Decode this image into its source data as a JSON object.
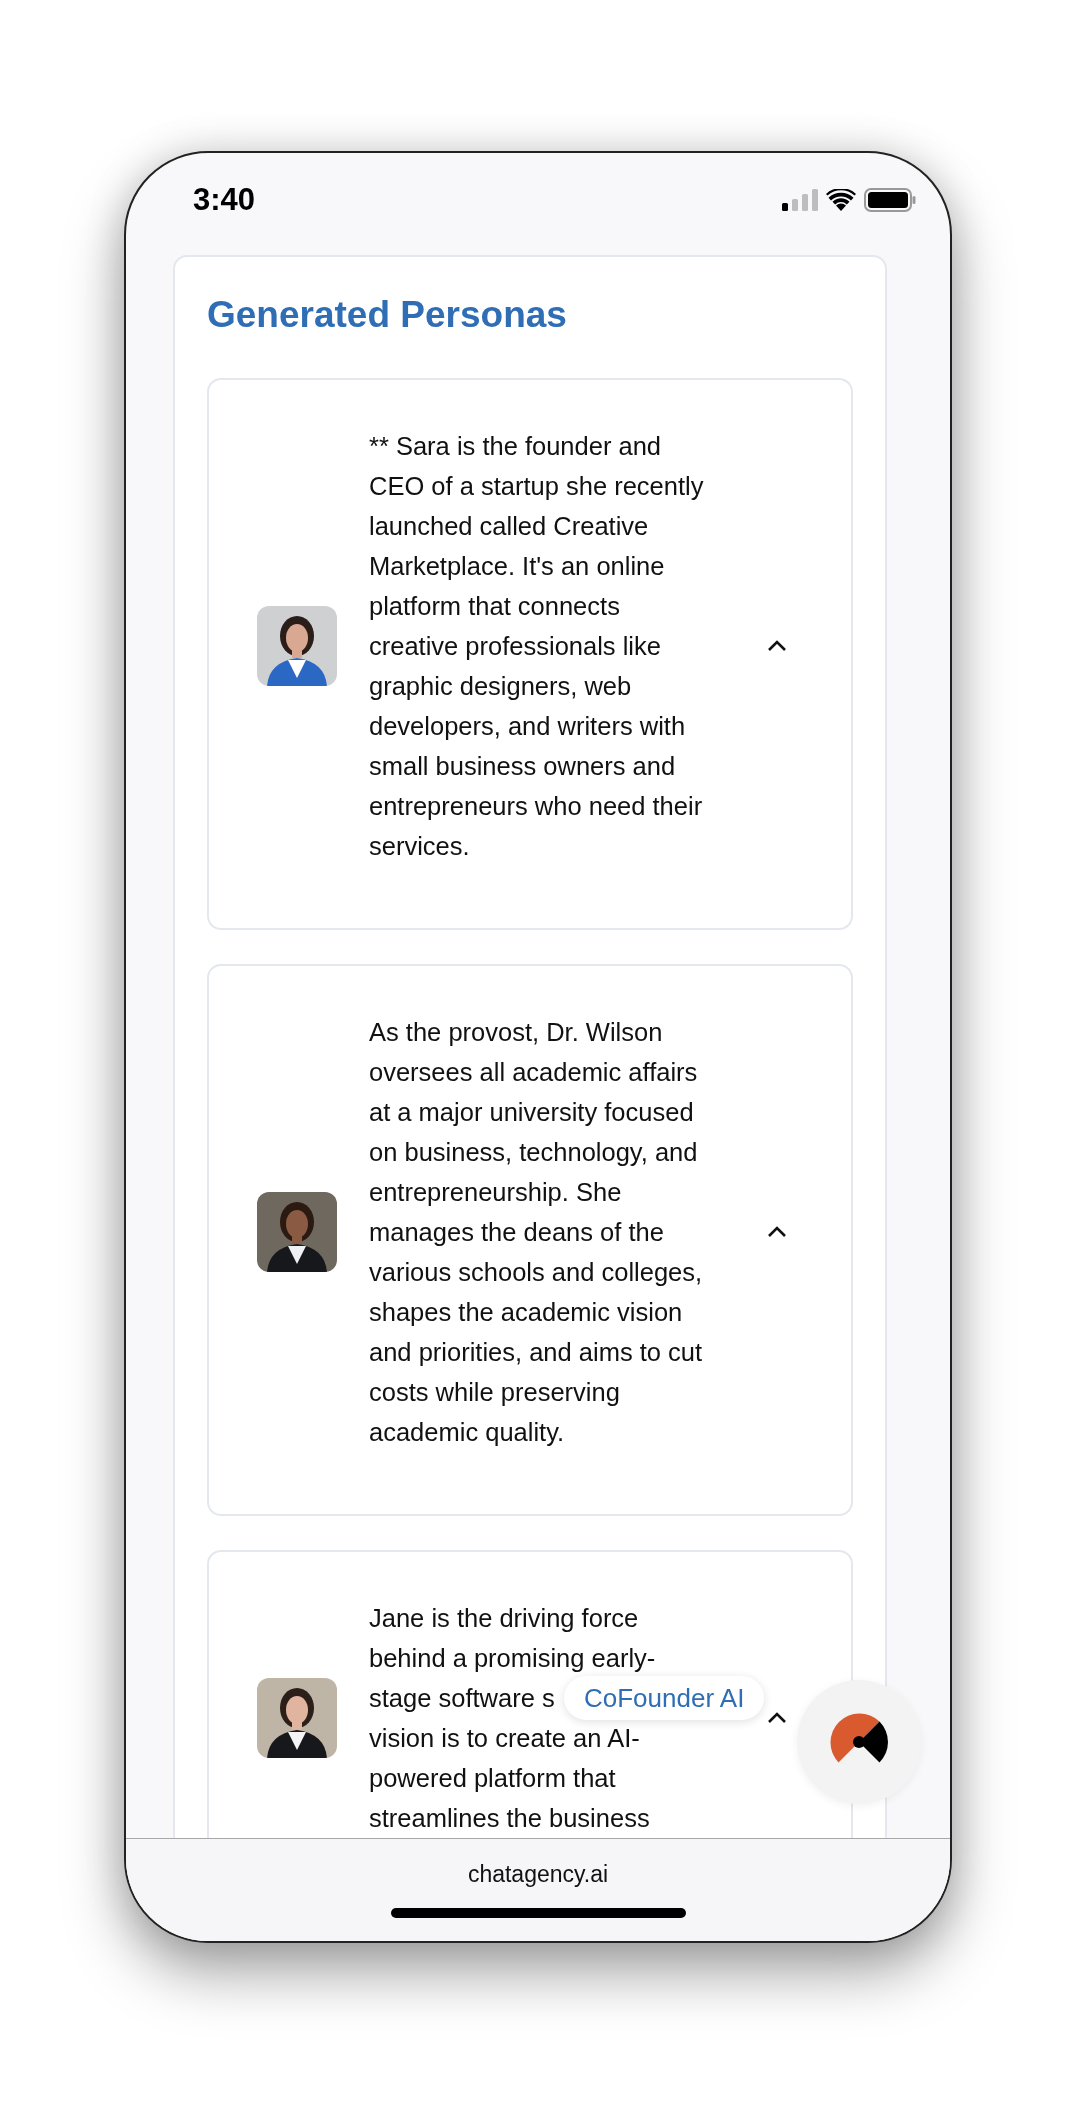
{
  "status_bar": {
    "time": "3:40"
  },
  "panel": {
    "title": "Generated Personas"
  },
  "personas": [
    {
      "expanded": true,
      "lines": [
        "** Sara is the founder and",
        "CEO of a startup she recently",
        "launched called Creative",
        "Marketplace. It's an online",
        "platform that connects",
        "creative professionals like",
        "graphic designers, web",
        "developers, and writers with",
        "small business owners and",
        "entrepreneurs who need their",
        "services."
      ]
    },
    {
      "expanded": true,
      "lines": [
        "As the provost, Dr. Wilson",
        "oversees all academic affairs",
        "at a major university focused",
        "on business, technology, and",
        "entrepreneurship. She",
        "manages the deans of the",
        "various schools and colleges,",
        "shapes the academic vision",
        "and priorities, and aims to cut",
        "costs while preserving",
        "academic quality."
      ]
    },
    {
      "expanded": true,
      "lines": [
        "Jane is the driving force",
        "behind a promising early-",
        "stage software s",
        "vision is to create an AI-",
        "powered platform that",
        "streamlines the business"
      ]
    }
  ],
  "assistant": {
    "label": "CoFounder AI"
  },
  "browser_bar": {
    "address": "chatagency.ai"
  }
}
